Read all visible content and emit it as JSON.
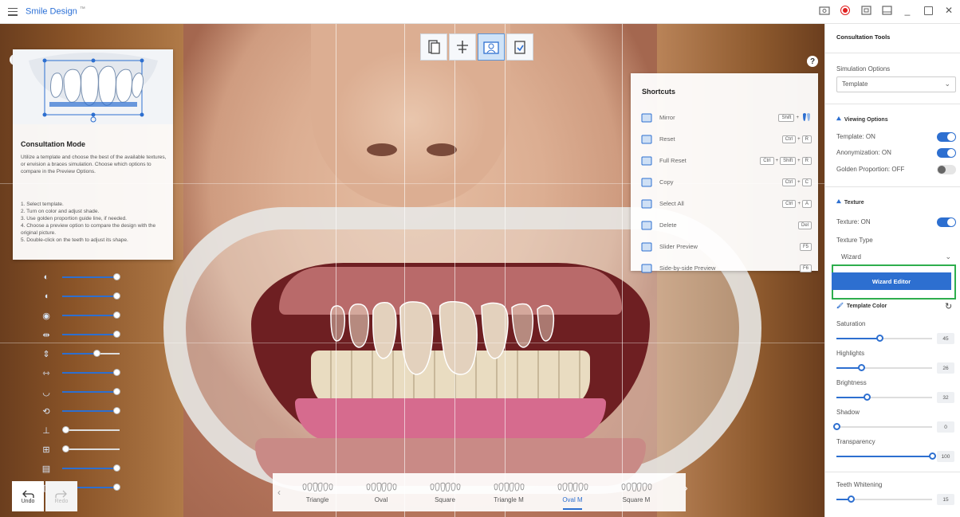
{
  "app": {
    "title": "Smile Design",
    "title_mark": "™"
  },
  "window_controls": [
    "screenshot-icon",
    "record-icon",
    "export-icon",
    "layout-icon",
    "minimize-icon",
    "maximize-icon",
    "close-icon"
  ],
  "view_toolbar": [
    "single-view-icon",
    "guide-lines-icon",
    "consultation-view-icon",
    "checklist-icon"
  ],
  "consultation": {
    "title": "Consultation Mode",
    "description": "Utilize a template and choose the best of the available textures, or envision a braces simulation. Choose which options to compare in the Preview Options.",
    "steps": [
      "1. Select template.",
      "2. Turn on color and adjust shade.",
      "3. Use golden proportion guide line, if needed.",
      "4. Choose a preview option to compare the design with the original picture.",
      "5. Double-click on the teeth to adjust its shape."
    ]
  },
  "left_sliders": [
    {
      "icon": "face-profile-icon",
      "value": 0.95
    },
    {
      "icon": "single-tooth-icon",
      "value": 0.95
    },
    {
      "icon": "tooth-color-icon",
      "value": 0.95
    },
    {
      "icon": "width-icon",
      "value": 0.95
    },
    {
      "icon": "length-icon",
      "value": 0.6
    },
    {
      "icon": "spacing-icon",
      "value": 0.95
    },
    {
      "icon": "curve-icon",
      "value": 0.95
    },
    {
      "icon": "rotation-icon",
      "value": 0.95
    },
    {
      "icon": "edge-icon",
      "value": 0.05
    },
    {
      "icon": "gap-icon",
      "value": 0.05
    },
    {
      "icon": "arch-icon",
      "value": 0.95
    },
    {
      "icon": "crowding-icon",
      "value": 0.95
    }
  ],
  "shortcuts": {
    "title": "Shortcuts",
    "items": [
      {
        "label": "Mirror",
        "icon": "mirror-icon",
        "keys": [
          "Shift",
          "+"
        ]
      },
      {
        "label": "Reset",
        "icon": "reset-icon",
        "keys": [
          "Ctrl",
          "+",
          "R"
        ]
      },
      {
        "label": "Full Reset",
        "icon": "full-reset-icon",
        "keys": [
          "Ctrl",
          "+",
          "Shift",
          "+",
          "R"
        ]
      },
      {
        "label": "Copy",
        "icon": "copy-icon",
        "keys": [
          "Ctrl",
          "+",
          "C"
        ]
      },
      {
        "label": "Select All",
        "icon": "select-all-icon",
        "keys": [
          "Ctrl",
          "+",
          "A"
        ]
      },
      {
        "label": "Delete",
        "icon": "trash-icon",
        "keys": [
          "Del"
        ]
      },
      {
        "label": "Slider Preview",
        "icon": "slider-preview-icon",
        "keys": [
          "F5"
        ]
      },
      {
        "label": "Side-by-side Preview",
        "icon": "side-by-side-icon",
        "keys": [
          "F6"
        ]
      }
    ]
  },
  "templates": {
    "items": [
      "Triangle",
      "Oval",
      "Square",
      "Triangle M",
      "Oval M",
      "Square M"
    ],
    "selected": "Oval M"
  },
  "history": {
    "undo": "Undo",
    "redo": "Redo"
  },
  "panel": {
    "title": "Consultation Tools",
    "simulation_label": "Simulation Options",
    "simulation_value": "Template",
    "viewing_title": "Viewing Options",
    "template_on": "Template: ON",
    "anonymization_on": "Anonymization: ON",
    "golden_off": "Golden Proportion: OFF",
    "texture_title": "Texture",
    "texture_on": "Texture: ON",
    "texture_type_label": "Texture Type",
    "texture_type_value": "Wizard",
    "wizard_button": "Wizard Editor",
    "template_color_title": "Template Color",
    "sliders": [
      {
        "label": "Saturation",
        "value": "45",
        "pct": 0.45
      },
      {
        "label": "Highlights",
        "value": "26",
        "pct": 0.26
      },
      {
        "label": "Brightness",
        "value": "32",
        "pct": 0.32
      },
      {
        "label": "Shadow",
        "value": "0",
        "pct": 0.0
      },
      {
        "label": "Transparency",
        "value": "100",
        "pct": 1.0
      }
    ],
    "whitening_label": "Teeth Whitening",
    "whitening_value": "15",
    "whitening_pct": 0.15
  },
  "colors": {
    "accent": "#2d6fd0",
    "highlight_box": "#2eae4d",
    "record": "#e02020"
  }
}
